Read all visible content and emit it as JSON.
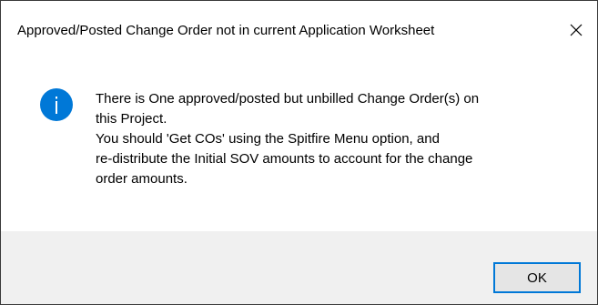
{
  "dialog": {
    "title": "Approved/Posted Change Order not in current Application Worksheet",
    "close_icon": "close-icon",
    "icon": "info-icon",
    "message_lines": [
      "There is One  approved/posted but unbilled Change Order(s) on",
      "this Project.",
      "You should 'Get COs' using the  Spitfire Menu option, and",
      "re-distribute the Initial SOV amounts to account for the change",
      "order amounts."
    ],
    "ok_label": "OK"
  },
  "colors": {
    "accent": "#0078d7",
    "footer_bg": "#f0f0f0",
    "button_bg": "#e5e5e5"
  }
}
